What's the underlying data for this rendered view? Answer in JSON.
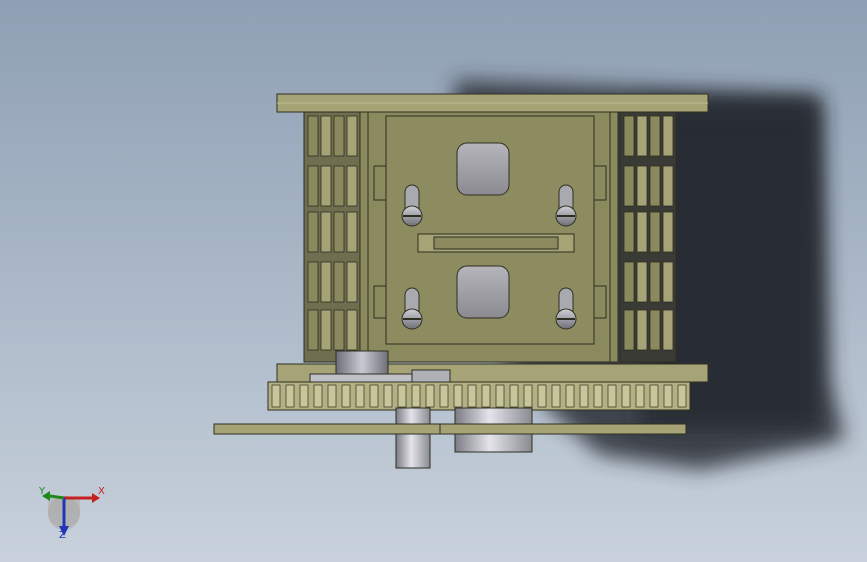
{
  "viewport": {
    "background_top": "#8fa0b4",
    "background_bottom": "#c8d1dc"
  },
  "model": {
    "part_color": "#8b8a5e",
    "plate_color": "#a6a476",
    "shaft_color": "#b9b9c0",
    "gear_color": "#b3b184",
    "shadow_color": "#2b2f36"
  },
  "triad": {
    "x_label": "X",
    "y_label": "Y",
    "z_label": "Z",
    "x_color": "#c62020",
    "y_color": "#1e8a1e",
    "z_color": "#2035b8"
  }
}
